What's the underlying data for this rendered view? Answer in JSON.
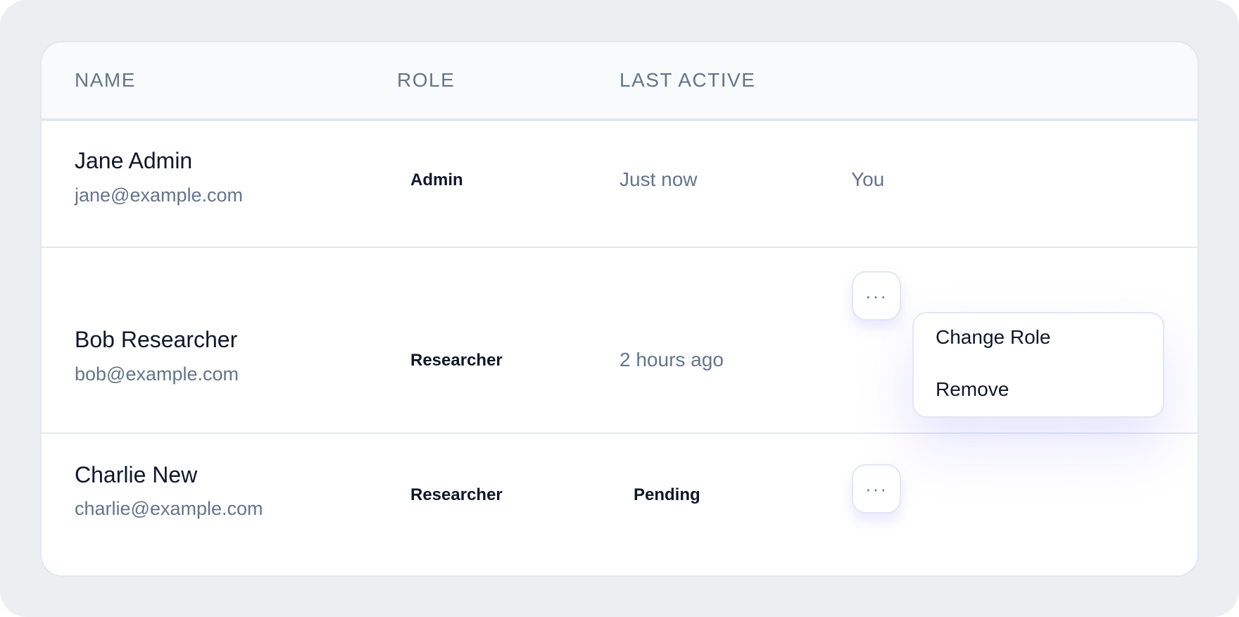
{
  "table": {
    "columns": {
      "name": "NAME",
      "role": "ROLE",
      "last_active": "LAST ACTIVE"
    },
    "rows": [
      {
        "name": "Jane Admin",
        "email": "jane@example.com",
        "role": "Admin",
        "last_active": "Just now",
        "note": "You"
      },
      {
        "name": "Bob Researcher",
        "email": "bob@example.com",
        "role": "Researcher",
        "last_active": "2 hours ago"
      },
      {
        "name": "Charlie New",
        "email": "charlie@example.com",
        "role": "Researcher",
        "status": "Pending"
      }
    ]
  },
  "more_button_label": "···",
  "action_menu": {
    "items": [
      "Change Role",
      "Remove"
    ]
  },
  "icons": {
    "more": "ellipsis-horizontal-icon"
  },
  "colors": {
    "page_bg": "#eceef2",
    "header_bg": "#f8fafc",
    "text_primary": "#0f172a",
    "text_secondary": "#64748b",
    "border": "#e3e8ef",
    "accent_shadow": "#8178ff"
  }
}
